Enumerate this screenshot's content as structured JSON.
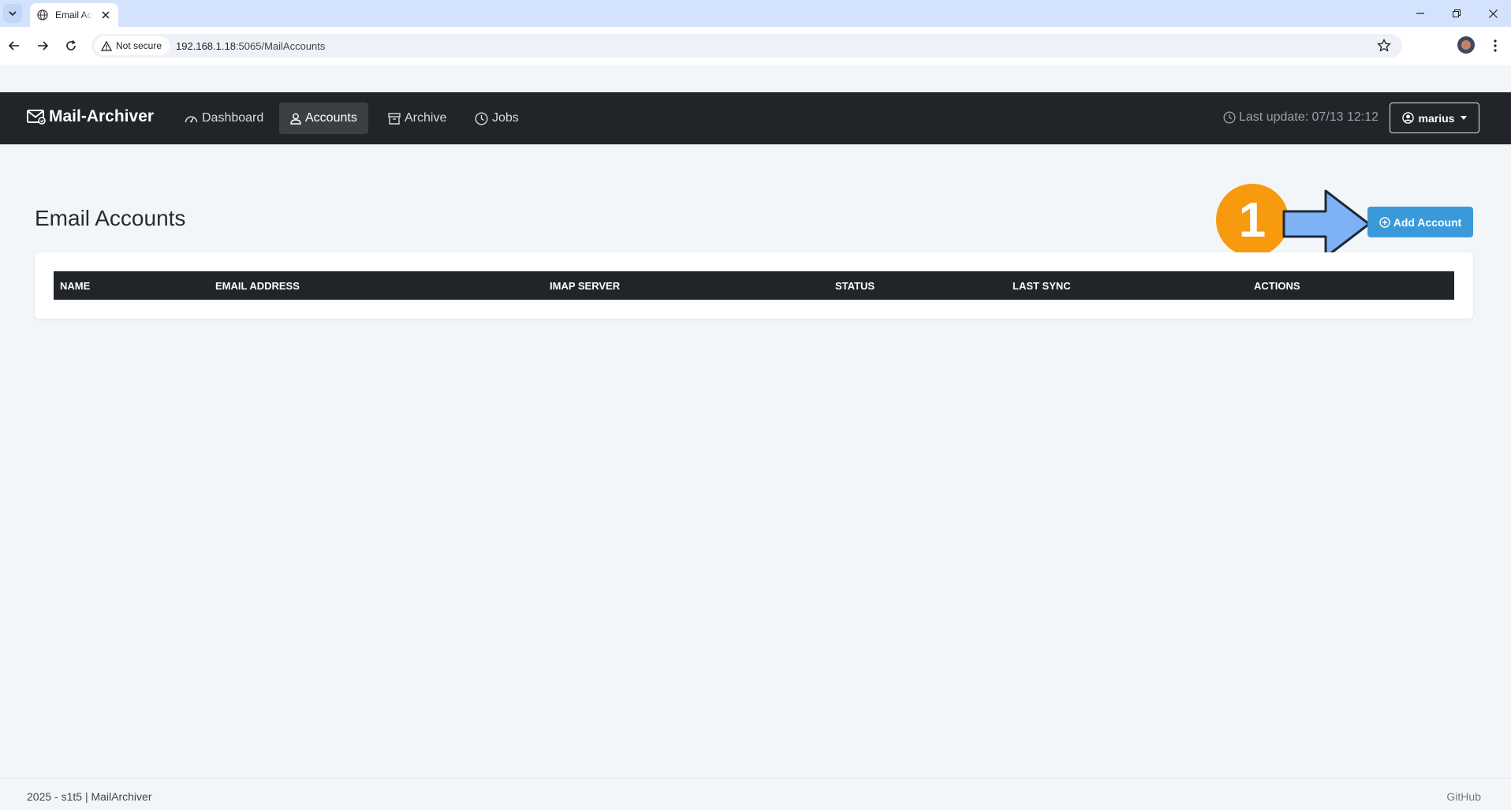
{
  "browser": {
    "tab_title": "Email Accounts",
    "security_label": "Not secure",
    "url_host": "192.168.1.18",
    "url_rest": ":5065/MailAccounts"
  },
  "navbar": {
    "brand": "Mail-Archiver",
    "items": [
      {
        "label": "Dashboard",
        "icon": "dashboard-icon"
      },
      {
        "label": "Accounts",
        "icon": "person-icon",
        "active": true
      },
      {
        "label": "Archive",
        "icon": "archive-icon"
      },
      {
        "label": "Jobs",
        "icon": "clock-icon"
      }
    ],
    "last_update": "Last update: 07/13 12:12",
    "user": "marius"
  },
  "page": {
    "title": "Email Accounts",
    "add_button": "Add Account",
    "callout_number": "1"
  },
  "table": {
    "columns": [
      "NAME",
      "EMAIL ADDRESS",
      "IMAP SERVER",
      "STATUS",
      "LAST SYNC",
      "ACTIONS"
    ],
    "rows": []
  },
  "footer": {
    "left": "2025 - s1t5 | MailArchiver",
    "right": "GitHub"
  },
  "colors": {
    "navbar_bg": "#212529",
    "primary": "#3a9ad9",
    "callout": "#f79a0e",
    "arrow": "#7fb2f5"
  }
}
